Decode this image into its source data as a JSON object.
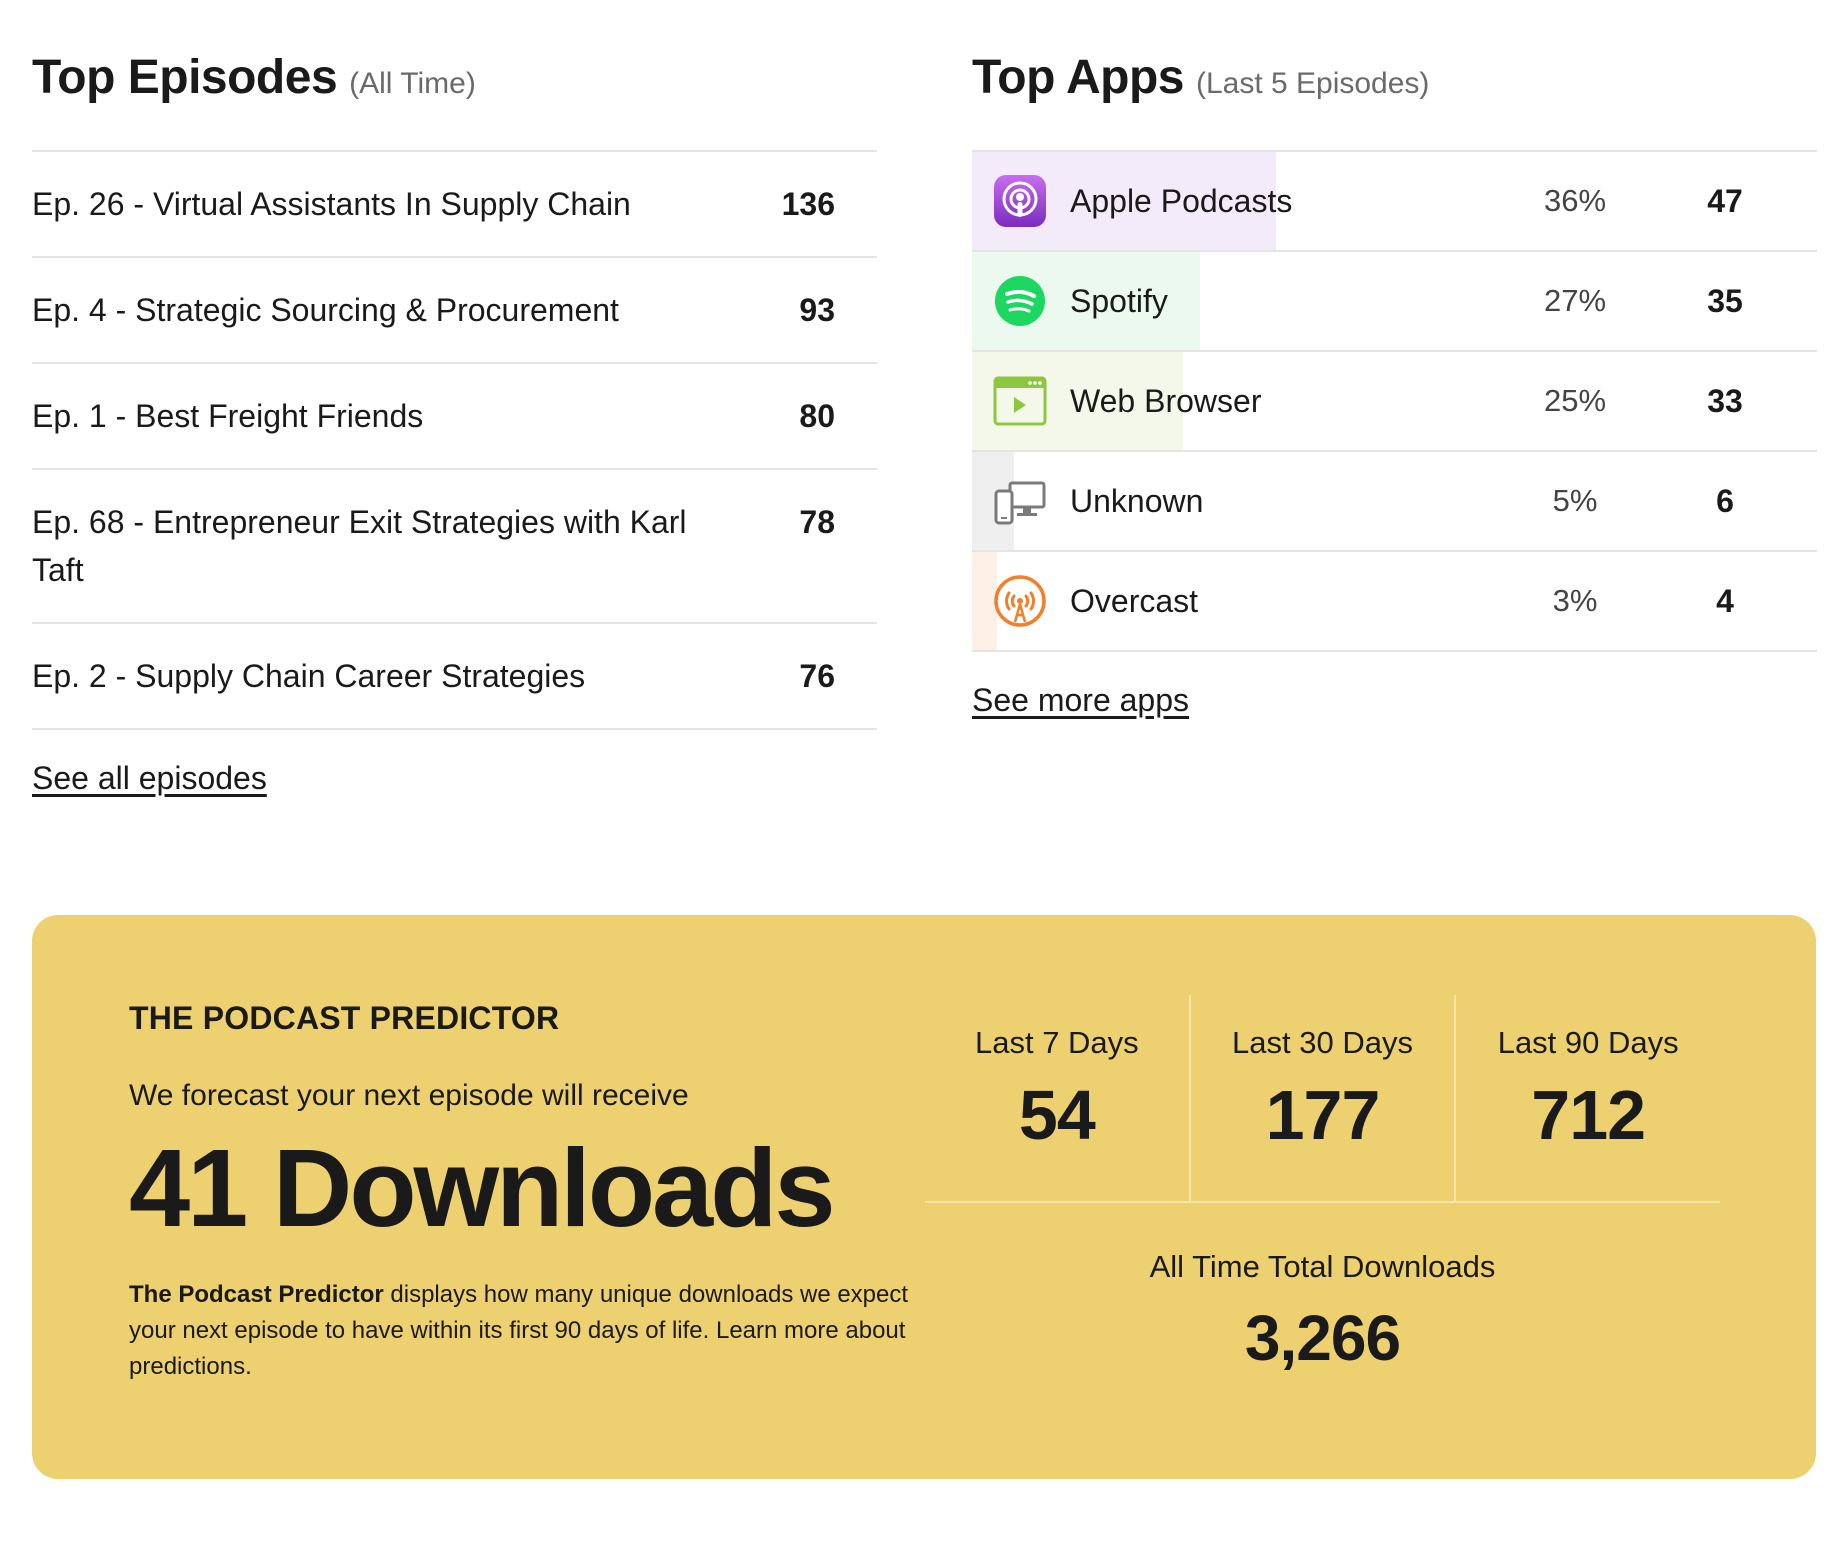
{
  "episodes": {
    "title": "Top Episodes",
    "subtitle": "(All Time)",
    "items": [
      {
        "title": "Ep. 26 - Virtual Assistants In Supply Chain",
        "count": "136"
      },
      {
        "title": "Ep. 4 - Strategic Sourcing & Procurement",
        "count": "93"
      },
      {
        "title": "Ep. 1 - Best Freight Friends",
        "count": "80"
      },
      {
        "title": "Ep. 68 - Entrepreneur Exit Strategies with Karl Taft",
        "count": "78"
      },
      {
        "title": "Ep. 2 - Supply Chain Career Strategies",
        "count": "76"
      }
    ],
    "link": "See all episodes"
  },
  "apps": {
    "title": "Top Apps",
    "subtitle": "(Last 5 Episodes)",
    "items": [
      {
        "name": "Apple Podcasts",
        "pct": "36%",
        "count": "47",
        "share": 0.36,
        "icon": "apple-podcasts-icon",
        "fill": "#f3eafa"
      },
      {
        "name": "Spotify",
        "pct": "27%",
        "count": "35",
        "share": 0.27,
        "icon": "spotify-icon",
        "fill": "#ecf9ee"
      },
      {
        "name": "Web Browser",
        "pct": "25%",
        "count": "33",
        "share": 0.25,
        "icon": "web-browser-icon",
        "fill": "#f3f8ea"
      },
      {
        "name": "Unknown",
        "pct": "5%",
        "count": "6",
        "share": 0.05,
        "icon": "devices-icon",
        "fill": "#efefef"
      },
      {
        "name": "Overcast",
        "pct": "3%",
        "count": "4",
        "share": 0.03,
        "icon": "overcast-icon",
        "fill": "#fdf0e6"
      }
    ],
    "link": "See more apps"
  },
  "predictor": {
    "label": "THE PODCAST PREDICTOR",
    "lead": "We forecast your next episode will receive",
    "big": "41 Downloads",
    "desc_bold": "The Podcast Predictor",
    "desc_rest": " displays how many unique downloads we expect your next episode to have within its first 90 days of life. Learn more about predictions.",
    "stats": [
      {
        "label": "Last 7 Days",
        "value": "54"
      },
      {
        "label": "Last 30 Days",
        "value": "177"
      },
      {
        "label": "Last 90 Days",
        "value": "712"
      }
    ],
    "total_label": "All Time Total Downloads",
    "total_value": "3,266"
  },
  "colors": {
    "predictor_bg": "#edd06f",
    "apple": "#9b3fd3",
    "spotify": "#1ed760",
    "web": "#8dc63f",
    "overcast": "#f47e2a"
  }
}
